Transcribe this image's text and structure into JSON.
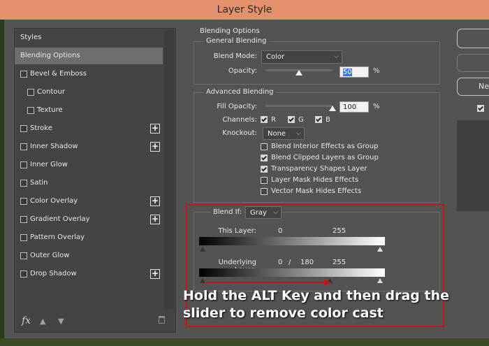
{
  "window": {
    "title": "Layer Style"
  },
  "sidebar": {
    "items": [
      {
        "label": "Styles",
        "checkbox": false,
        "plus": false,
        "selected": false
      },
      {
        "label": "Blending Options",
        "checkbox": false,
        "plus": false,
        "selected": true
      },
      {
        "label": "Bevel & Emboss",
        "checkbox": true,
        "plus": false,
        "selected": false
      },
      {
        "label": "Contour",
        "checkbox": true,
        "plus": false,
        "selected": false
      },
      {
        "label": "Texture",
        "checkbox": true,
        "plus": false,
        "selected": false
      },
      {
        "label": "Stroke",
        "checkbox": true,
        "plus": true,
        "selected": false
      },
      {
        "label": "Inner Shadow",
        "checkbox": true,
        "plus": true,
        "selected": false
      },
      {
        "label": "Inner Glow",
        "checkbox": true,
        "plus": false,
        "selected": false
      },
      {
        "label": "Satin",
        "checkbox": true,
        "plus": false,
        "selected": false
      },
      {
        "label": "Color Overlay",
        "checkbox": true,
        "plus": true,
        "selected": false
      },
      {
        "label": "Gradient Overlay",
        "checkbox": true,
        "plus": true,
        "selected": false
      },
      {
        "label": "Pattern Overlay",
        "checkbox": true,
        "plus": false,
        "selected": false
      },
      {
        "label": "Outer Glow",
        "checkbox": true,
        "plus": false,
        "selected": false
      },
      {
        "label": "Drop Shadow",
        "checkbox": true,
        "plus": true,
        "selected": false
      }
    ],
    "fx_label": "fx"
  },
  "blending": {
    "section_title": "Blending Options",
    "general": {
      "title": "General Blending",
      "blend_mode_label": "Blend Mode:",
      "blend_mode_value": "Color",
      "opacity_label": "Opacity:",
      "opacity_value": "50",
      "opacity_unit": "%",
      "opacity_fraction": 0.5
    },
    "advanced": {
      "title": "Advanced Blending",
      "fill_opacity_label": "Fill Opacity:",
      "fill_opacity_value": "100",
      "fill_opacity_unit": "%",
      "fill_opacity_fraction": 1.0,
      "channels_label": "Channels:",
      "channels": [
        {
          "label": "R",
          "checked": true
        },
        {
          "label": "G",
          "checked": true
        },
        {
          "label": "B",
          "checked": true
        }
      ],
      "knockout_label": "Knockout:",
      "knockout_value": "None",
      "options": [
        {
          "label": "Blend Interior Effects as Group",
          "checked": false
        },
        {
          "label": "Blend Clipped Layers as Group",
          "checked": true
        },
        {
          "label": "Transparency Shapes Layer",
          "checked": true
        },
        {
          "label": "Layer Mask Hides Effects",
          "checked": false
        },
        {
          "label": "Vector Mask Hides Effects",
          "checked": false
        }
      ]
    },
    "blend_if": {
      "label": "Blend If:",
      "value": "Gray",
      "this_layer_label": "This Layer:",
      "this_layer_low": "0",
      "this_layer_high": "255",
      "underlying_label": "Underlying Layer:",
      "underlying_low": "0",
      "underlying_sep": "/",
      "underlying_split": "180",
      "underlying_high": "255"
    }
  },
  "right_buttons": {
    "partial_label": "Ne"
  },
  "caption": {
    "text": "Hold the ALT Key and then drag the slider to remove color cast"
  }
}
